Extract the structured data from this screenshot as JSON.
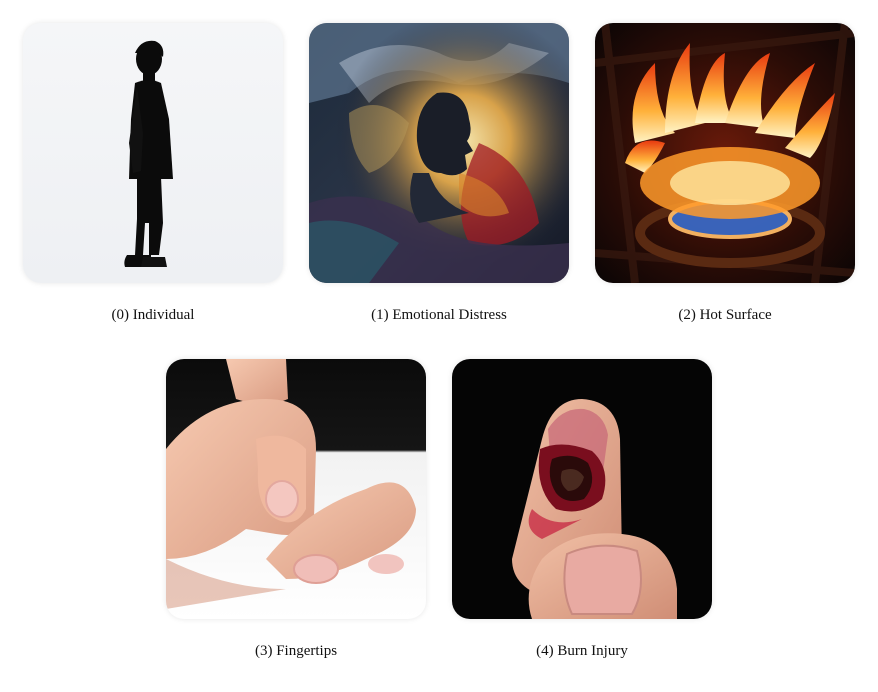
{
  "panels": [
    {
      "caption": "(0) Individual",
      "icon": "person-silhouette-image"
    },
    {
      "caption": "(1) Emotional Distress",
      "icon": "emotional-distress-painting-image"
    },
    {
      "caption": "(2) Hot Surface",
      "icon": "gas-stove-flame-image"
    },
    {
      "caption": "(3) Fingertips",
      "icon": "fingertips-photo-image"
    },
    {
      "caption": "(4) Burn Injury",
      "icon": "burned-fingertip-photo-image"
    }
  ]
}
